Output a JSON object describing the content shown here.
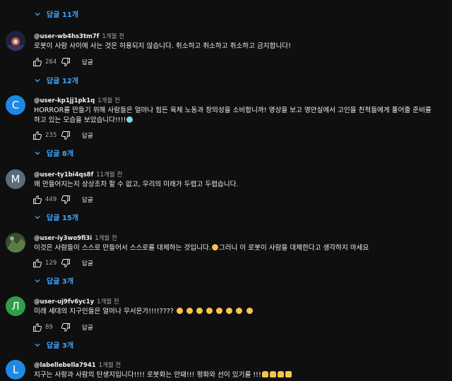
{
  "top_replies": {
    "label": "답글 11개"
  },
  "comments": [
    {
      "handle": "@user-wb4hs3tm7f",
      "time": "1개월 전",
      "text": "로봇이 사람 사이에 사는 것은 허용되지 않습니다. 취소하고 취소하고 취소하고 금지합니다!",
      "likes": "264",
      "reply_label": "답글",
      "replies_label": "답글 12개",
      "avatar_letter": "",
      "avatar_color": "#2a2d44"
    },
    {
      "handle": "@user-kp1jj1pk1q",
      "time": "1개월 전",
      "text_line1": "HORROR를 만들기 위해 사람들은 얼마나 힘든 육체 노동과 창의성을 소비합니까! 영상을 보고 영안실에서 고인을 친척들에게 풀어줄 준비를",
      "text_line2": "하고 있는 모습을 보았습니다!!!!",
      "likes": "235",
      "reply_label": "답글",
      "replies_label": "답글 8개",
      "avatar_letter": "C",
      "avatar_color": "#1e88e5"
    },
    {
      "handle": "@user-ty1bi4qs8f",
      "time": "11개월 전",
      "text": "왜 만들어지는지 상상조차 할 수 없고, 우리의 미래가 두렵고 두렵습니다.",
      "likes": "449",
      "reply_label": "답글",
      "replies_label": "답글 15개",
      "avatar_letter": "M",
      "avatar_color": "#5c6b7a"
    },
    {
      "handle": "@user-iy3wo9fi3i",
      "time": "1개월 전",
      "text_a": "이것은 사람들이 스스로 만들어서 스스로를 대체하는 것입니다.",
      "text_b": "그러니 이 로봇이 사람을 대체한다고 생각하지 마세요",
      "likes": "129",
      "reply_label": "답글",
      "replies_label": "답글 3개",
      "avatar_letter": "",
      "avatar_color": "#4a5a3a"
    },
    {
      "handle": "@user-uj9fv6yc1y",
      "time": "1개월 전",
      "text": "미래 세대의 지구인들은 얼마나 무서운가!!!!????",
      "likes": "89",
      "reply_label": "답글",
      "replies_label": "답글 3개",
      "avatar_letter": "Л",
      "avatar_color": "#2e9e4a"
    },
    {
      "handle": "@labellebella7941",
      "time": "1개월 전",
      "text": "지구는 사랑과 사람의 탄생지입니다!!!! 로봇화는 안돼!!! 평화와 선이 있기를 !!!",
      "avatar_letter": "L",
      "avatar_color": "#1e88e5"
    }
  ],
  "icons": {
    "like": "thumb-up-icon",
    "dislike": "thumb-down-icon",
    "chevron": "chevron-down-icon"
  },
  "colors": {
    "background": "#0f0f0f",
    "link": "#3ea6ff",
    "text": "#f1f1f1",
    "muted": "#aaaaaa"
  }
}
